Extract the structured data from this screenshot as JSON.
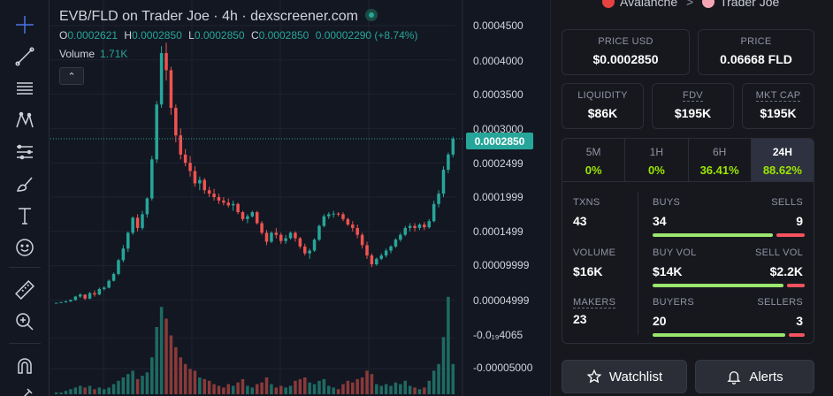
{
  "chart_header": {
    "title": "EVB/FLD on Trader Joe · 4h · dexscreener.com",
    "ohlc": {
      "o_label": "O",
      "o": "0.0002621",
      "h_label": "H",
      "h": "0.0002850",
      "l_label": "L",
      "l": "0.0002850",
      "c_label": "C",
      "c": "0.0002850",
      "change": "0.00002290 (+8.74%)"
    },
    "volume_label": "Volume",
    "volume_value": "1.71K",
    "collapse_glyph": "⌃"
  },
  "price_axis": {
    "labels": [
      "0.0004500",
      "0.0004000",
      "0.0003500",
      "0.0003000",
      "0.0002499",
      "0.0001999",
      "0.0001499",
      "0.00009999",
      "0.00004999",
      "-0.0₁₉4065",
      "-0.00005000"
    ],
    "current_price": "0.0002850"
  },
  "toolbar": {
    "tools": [
      "crosshair-icon",
      "trend-line-icon",
      "horizontal-lines-icon",
      "pattern-icon",
      "projection-icon",
      "brush-icon",
      "text-icon",
      "emoji-icon",
      "ruler-icon",
      "zoom-in-icon",
      "magnet-icon",
      "pencil-lock-icon"
    ]
  },
  "panel": {
    "breadcrumb": {
      "chain": "Avalanche",
      "separator": ">",
      "dex": "Trader Joe"
    },
    "price_usd": {
      "label": "PRICE USD",
      "value": "$0.0002850"
    },
    "price": {
      "label": "PRICE",
      "value": "0.06668 FLD"
    },
    "liquidity": {
      "label": "LIQUIDITY",
      "value": "$86K"
    },
    "fdv": {
      "label": "FDV",
      "value": "$195K"
    },
    "mkt_cap": {
      "label": "MKT CAP",
      "value": "$195K"
    },
    "timeframes": [
      {
        "label": "5M",
        "value": "0%"
      },
      {
        "label": "1H",
        "value": "0%"
      },
      {
        "label": "6H",
        "value": "36.41%"
      },
      {
        "label": "24H",
        "value": "88.62%"
      }
    ],
    "txns": {
      "label": "TXNS",
      "value": "43"
    },
    "buys": {
      "label": "BUYS",
      "value": "34",
      "ratio": 0.79
    },
    "sells": {
      "label": "SELLS",
      "value": "9"
    },
    "volume": {
      "label": "VOLUME",
      "value": "$16K"
    },
    "buy_vol": {
      "label": "BUY VOL",
      "value": "$14K",
      "ratio": 0.86
    },
    "sell_vol": {
      "label": "SELL VOL",
      "value": "$2.2K"
    },
    "makers": {
      "label": "MAKERS",
      "value": "23"
    },
    "buyers": {
      "label": "BUYERS",
      "value": "20",
      "ratio": 0.87
    },
    "sellers": {
      "label": "SELLERS",
      "value": "3"
    },
    "watchlist_label": "Watchlist",
    "alerts_label": "Alerts"
  },
  "colors": {
    "up": "#26a69a",
    "down": "#ef5350",
    "accent": "#9ae600",
    "background": "#131722"
  },
  "chart_data": {
    "type": "candlestick",
    "timeframe": "4h",
    "ylim": [
      -5e-05,
      0.00048
    ],
    "current_price": 0.000285,
    "candles": [
      [
        4.5e-05,
        4.6e-05,
        4.5e-05,
        4.6e-05,
        1
      ],
      [
        4.6e-05,
        4.7e-05,
        4.6e-05,
        4.7e-05,
        1
      ],
      [
        4.7e-05,
        4.9e-05,
        4.6e-05,
        4.8e-05,
        2
      ],
      [
        4.8e-05,
        5.1e-05,
        4.7e-05,
        5e-05,
        3
      ],
      [
        5e-05,
        5.6e-05,
        4.9e-05,
        5.5e-05,
        4
      ],
      [
        5.5e-05,
        6e-05,
        5.3e-05,
        5.8e-05,
        5
      ],
      [
        5.8e-05,
        5.8e-05,
        5e-05,
        5.2e-05,
        4
      ],
      [
        5.2e-05,
        6.2e-05,
        5.1e-05,
        6e-05,
        5
      ],
      [
        6e-05,
        6.4e-05,
        5.5e-05,
        5.8e-05,
        3
      ],
      [
        5.8e-05,
        6.8e-05,
        5.7e-05,
        6.6e-05,
        4
      ],
      [
        6.6e-05,
        7e-05,
        6.4e-05,
        6.8e-05,
        3
      ],
      [
        6.8e-05,
        8e-05,
        6.7e-05,
        7.8e-05,
        4
      ],
      [
        7.8e-05,
        9e-05,
        7.7e-05,
        8.8e-05,
        6
      ],
      [
        8.8e-05,
        0.00011,
        8.6e-05,
        0.000108,
        8
      ],
      [
        0.000108,
        0.00013,
        0.000105,
        0.000125,
        10
      ],
      [
        0.000125,
        0.00015,
        0.00012,
        0.000148,
        12
      ],
      [
        0.000148,
        0.000172,
        0.000145,
        0.00017,
        14
      ],
      [
        0.00017,
        0.000175,
        0.00015,
        0.000155,
        9
      ],
      [
        0.000155,
        0.00018,
        0.000152,
        0.000175,
        11
      ],
      [
        0.000175,
        0.0002,
        0.00017,
        0.000198,
        13
      ],
      [
        0.000198,
        0.00026,
        0.000195,
        0.000255,
        22
      ],
      [
        0.000255,
        0.00034,
        0.00025,
        0.000335,
        40
      ],
      [
        0.000335,
        0.00042,
        0.00033,
        0.00041,
        52
      ],
      [
        0.00041,
        0.000425,
        0.00037,
        0.000385,
        45
      ],
      [
        0.000385,
        0.00039,
        0.00032,
        0.00033,
        35
      ],
      [
        0.00033,
        0.000335,
        0.00028,
        0.00029,
        28
      ],
      [
        0.00029,
        0.0003,
        0.000255,
        0.000262,
        22
      ],
      [
        0.000262,
        0.00027,
        0.000245,
        0.00025,
        18
      ],
      [
        0.00025,
        0.00026,
        0.00023,
        0.000238,
        15
      ],
      [
        0.000238,
        0.000245,
        0.000215,
        0.00022,
        14
      ],
      [
        0.00022,
        0.00023,
        0.00021,
        0.000225,
        10
      ],
      [
        0.000225,
        0.000228,
        0.000205,
        0.00021,
        9
      ],
      [
        0.00021,
        0.000215,
        0.0002,
        0.000205,
        8
      ],
      [
        0.000205,
        0.000212,
        0.000195,
        0.0002,
        6
      ],
      [
        0.0002,
        0.000205,
        0.00019,
        0.000195,
        5
      ],
      [
        0.000195,
        0.0002,
        0.000188,
        0.000192,
        4
      ],
      [
        0.000192,
        0.000198,
        0.000185,
        0.000188,
        6
      ],
      [
        0.000188,
        0.000195,
        0.00018,
        0.00019,
        5
      ],
      [
        0.00019,
        0.000192,
        0.000175,
        0.000178,
        7
      ],
      [
        0.000178,
        0.00018,
        0.000165,
        0.000168,
        9
      ],
      [
        0.000168,
        0.000175,
        0.000162,
        0.000172,
        5
      ],
      [
        0.000172,
        0.00018,
        0.00017,
        0.000178,
        4
      ],
      [
        0.000178,
        0.00018,
        0.00016,
        0.000162,
        6
      ],
      [
        0.000162,
        0.000165,
        0.000145,
        0.000148,
        7
      ],
      [
        0.000148,
        0.000152,
        0.00013,
        0.000135,
        10
      ],
      [
        0.000135,
        0.00015,
        0.000133,
        0.000148,
        6
      ],
      [
        0.000148,
        0.000155,
        0.00014,
        0.000145,
        4
      ],
      [
        0.000145,
        0.000148,
        0.000132,
        0.000136,
        5
      ],
      [
        0.000136,
        0.000145,
        0.000132,
        0.00014,
        4
      ],
      [
        0.00014,
        0.00015,
        0.000138,
        0.000148,
        5
      ],
      [
        0.000148,
        0.00015,
        0.000135,
        0.00014,
        8
      ],
      [
        0.00014,
        0.000142,
        0.000125,
        0.000128,
        9
      ],
      [
        0.000128,
        0.000132,
        0.000115,
        0.000118,
        10
      ],
      [
        0.000118,
        0.000125,
        0.00011,
        0.000122,
        7
      ],
      [
        0.000122,
        0.00014,
        0.00012,
        0.000138,
        6
      ],
      [
        0.000138,
        0.00016,
        0.000136,
        0.000158,
        8
      ],
      [
        0.000158,
        0.000175,
        0.000156,
        0.000172,
        9
      ],
      [
        0.000172,
        0.000178,
        0.000168,
        0.000175,
        5
      ],
      [
        0.000175,
        0.00018,
        0.00017,
        0.000176,
        4
      ],
      [
        0.000176,
        0.000178,
        0.000172,
        0.000175,
        3
      ],
      [
        0.000175,
        0.000178,
        0.000165,
        0.000168,
        6
      ],
      [
        0.000168,
        0.00017,
        0.000158,
        0.00016,
        8
      ],
      [
        0.00016,
        0.000165,
        0.00015,
        0.000155,
        7
      ],
      [
        0.000155,
        0.00016,
        0.00014,
        0.000145,
        9
      ],
      [
        0.000145,
        0.000148,
        0.000125,
        0.00013,
        10
      ],
      [
        0.00013,
        0.000135,
        0.00011,
        0.000115,
        14
      ],
      [
        0.000115,
        0.000118,
        9.8e-05,
        0.000102,
        12
      ],
      [
        0.000102,
        0.000112,
        0.0001,
        0.00011,
        6
      ],
      [
        0.00011,
        0.000118,
        0.000108,
        0.000115,
        5
      ],
      [
        0.000115,
        0.000125,
        0.000112,
        0.000122,
        6
      ],
      [
        0.000122,
        0.00013,
        0.000118,
        0.000128,
        5
      ],
      [
        0.000128,
        0.00014,
        0.000126,
        0.000138,
        7
      ],
      [
        0.000138,
        0.000148,
        0.000135,
        0.000145,
        6
      ],
      [
        0.000145,
        0.000158,
        0.000143,
        0.000155,
        8
      ],
      [
        0.000155,
        0.000162,
        0.00015,
        0.000158,
        5
      ],
      [
        0.000158,
        0.000162,
        0.00015,
        0.000155,
        4
      ],
      [
        0.000155,
        0.000162,
        0.000152,
        0.00016,
        3
      ],
      [
        0.00016,
        0.000164,
        0.000152,
        0.000156,
        4
      ],
      [
        0.000156,
        0.000168,
        0.000154,
        0.000165,
        8
      ],
      [
        0.000165,
        0.000195,
        0.000163,
        0.00019,
        14
      ],
      [
        0.00019,
        0.00021,
        0.000185,
        0.000205,
        18
      ],
      [
        0.000205,
        0.000245,
        0.0002,
        0.00024,
        34
      ],
      [
        0.00024,
        0.000265,
        0.000235,
        0.000262,
        58
      ],
      [
        0.000262,
        0.000288,
        0.000258,
        0.000285,
        18
      ]
    ]
  }
}
